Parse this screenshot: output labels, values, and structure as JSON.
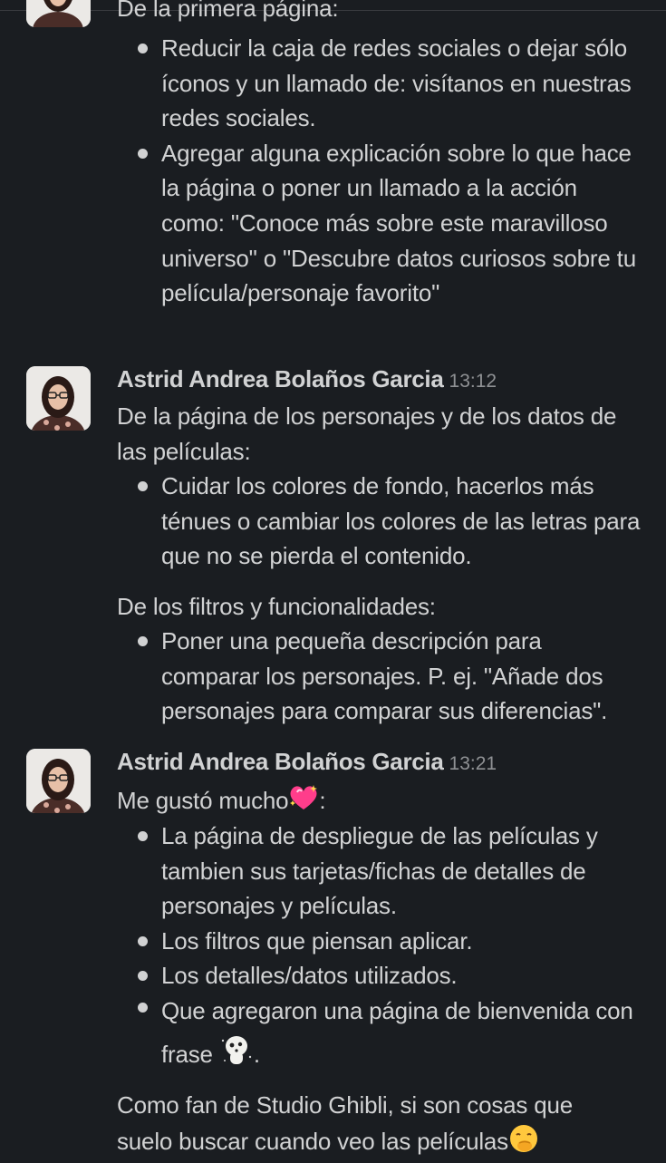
{
  "top_fragment": {
    "intro": "De la primera página:",
    "bullets": [
      "Reducir la caja de redes sociales o dejar sólo íconos y un llamado de: visítanos en nuestras redes sociales.",
      "Agregar alguna explicación sobre lo que hace la página o poner un llamado a la acción como: \"Conoce más sobre este maravilloso universo\" o \"Descubre datos curiosos sobre tu película/personaje favorito\""
    ]
  },
  "messages": [
    {
      "author": "Astrid Andrea Bolaños Garcia",
      "time": "13:12",
      "section1_intro": "De la página de los personajes y de los datos de las películas:",
      "section1_bullets": [
        "Cuidar los colores de fondo, hacerlos más ténues o cambiar los colores de las letras para que no se pierda el contenido."
      ],
      "section2_intro": "De los filtros y funcionalidades:",
      "section2_bullets": [
        "Poner una pequeña descripción para comparar los personajes. P. ej. \"Añade dos personajes para comparar sus diferencias\"."
      ]
    },
    {
      "author": "Astrid Andrea Bolaños Garcia",
      "time": "13:21",
      "intro_text": "Me gustó mucho",
      "intro_suffix": ":",
      "bullets": [
        "La página de despliegue de las películas y tambien sus tarjetas/fichas de detalles de personajes y películas.",
        "Los filtros que piensan aplicar.",
        "Los detalles/datos utilizados."
      ],
      "last_bullet_text": "Que agregaron una página de bienvenida con frase",
      "last_bullet_suffix": ".",
      "closing_text": "Como fan de Studio Ghibli, si son cosas que suelo buscar cuando veo las películas",
      "emojis": [
        "sparkling-heart-emoji",
        "kodama-emoji",
        "hand-over-mouth-emoji"
      ]
    }
  ]
}
